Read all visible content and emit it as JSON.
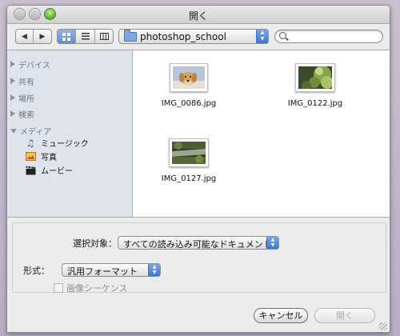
{
  "window": {
    "title": "開く"
  },
  "toolbar": {
    "nav_back_icon": "chevron-left-icon",
    "nav_forward_icon": "chevron-right-icon",
    "view_icons": [
      "icon-view-icon",
      "list-view-icon",
      "column-view-icon"
    ],
    "path_folder": "photoshop_school",
    "search_placeholder": ""
  },
  "sidebar": {
    "sections": [
      {
        "label": "デバイス",
        "open": false
      },
      {
        "label": "共有",
        "open": false
      },
      {
        "label": "場所",
        "open": false
      },
      {
        "label": "検索",
        "open": false
      },
      {
        "label": "メディア",
        "open": true
      }
    ],
    "media_items": [
      {
        "label": "ミュージック",
        "icon": "music-note-icon"
      },
      {
        "label": "写真",
        "icon": "photo-icon"
      },
      {
        "label": "ムービー",
        "icon": "movie-clapper-icon"
      }
    ]
  },
  "files": [
    {
      "name": "IMG_0086.jpg"
    },
    {
      "name": "IMG_0122.jpg"
    },
    {
      "name": "IMG_0127.jpg"
    }
  ],
  "options": {
    "enable_label": "選択対象：",
    "enable_value": "すべての読み込み可能なドキュメント",
    "format_label": "形式：",
    "format_value": "汎用フォーマット",
    "sequence_label": "画像シーケンス",
    "sequence_checked": false
  },
  "buttons": {
    "cancel": "キャンセル",
    "open": "開く"
  }
}
